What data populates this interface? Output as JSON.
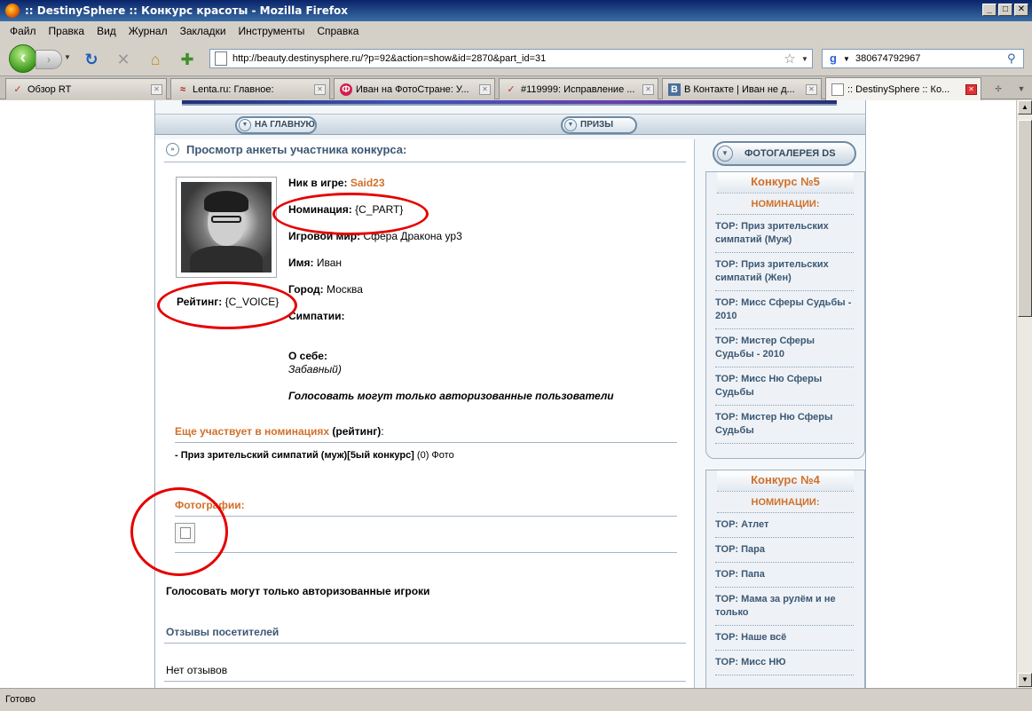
{
  "window": {
    "title": ":: DestinySphere :: Конкурс красоты - Mozilla Firefox",
    "min": "_",
    "max": "□",
    "close": "✕"
  },
  "menu": [
    "Файл",
    "Правка",
    "Вид",
    "Журнал",
    "Закладки",
    "Инструменты",
    "Справка"
  ],
  "nav": {
    "url": "http://beauty.destinysphere.ru/?p=92&action=show&id=2870&part_id=31",
    "search_value": "380674792967"
  },
  "tabs": [
    {
      "label": "Обзор RT",
      "icon": "✓"
    },
    {
      "label": "Lenta.ru: Главное:",
      "icon": "≈"
    },
    {
      "label": "Иван на ФотоСтране: У...",
      "icon": "Ф"
    },
    {
      "label": "#119999: Исправление ...",
      "icon": "✓"
    },
    {
      "label": "В Контакте | Иван не д...",
      "icon": "В"
    },
    {
      "label": ":: DestinySphere :: Ко...",
      "icon": ""
    }
  ],
  "page": {
    "nav_home": "НА ГЛАВНУЮ",
    "nav_prizes": "ПРИЗЫ",
    "title": "Просмотр анкеты участника конкурса:",
    "rating_label": "Рейтинг:",
    "rating_value": "{C_VOICE}",
    "nick_label": "Ник в игре:",
    "nick_value": "Said23",
    "nomination_label": "Номинация:",
    "nomination_value": "{C_PART}",
    "world_label": "Игровой мир:",
    "world_value": "Сфера Дракона ур3",
    "name_label": "Имя:",
    "name_value": "Иван",
    "city_label": "Город:",
    "city_value": "Москва",
    "likes_label": "Симпатии:",
    "about_label": "О себе:",
    "about_value": "Забавный)",
    "vote_users_notice": "Голосовать могут только авторизованные пользователи",
    "also_title_orange": "Еще участвует в номинациях",
    "also_title_rating": "(рейтинг)",
    "also_title_colon": ":",
    "also_item_bold": "- Приз зрительский симпатий (муж)[5ый конкурс]",
    "also_item_rest": "(0) Фото",
    "photos_title": "Фотографии:",
    "vote_players_notice": "Голосовать могут только авторизованные игроки",
    "reviews_title": "Отзывы посетителей",
    "no_reviews": "Нет отзывов"
  },
  "sidebar": {
    "gallery": "ФОТОГАЛЕРЕЯ DS",
    "contest5": {
      "title": "Конкурс №5",
      "sub": "НОМИНАЦИИ:",
      "items": [
        "TOP: Приз зрительских симпатий (Муж)",
        "TOP: Приз зрительских симпатий (Жен)",
        "TOP: Мисс Сферы Судьбы - 2010",
        "TOP: Мистер Сферы Судьбы - 2010",
        "TOP: Мисс Ню Сферы Судьбы",
        "TOP: Мистер Ню Сферы Судьбы"
      ]
    },
    "contest4": {
      "title": "Конкурс №4",
      "sub": "НОМИНАЦИИ:",
      "items": [
        "TOP: Атлет",
        "TOP: Пара",
        "TOP: Папа",
        "TOP: Мама за рулём и не только",
        "TOP: Наше всё",
        "TOP: Мисс НЮ"
      ]
    }
  },
  "status": "Готово",
  "colors": {
    "accent_orange": "#d0702a",
    "heading_blue": "#3c5874",
    "annotation_red": "#e60000"
  }
}
